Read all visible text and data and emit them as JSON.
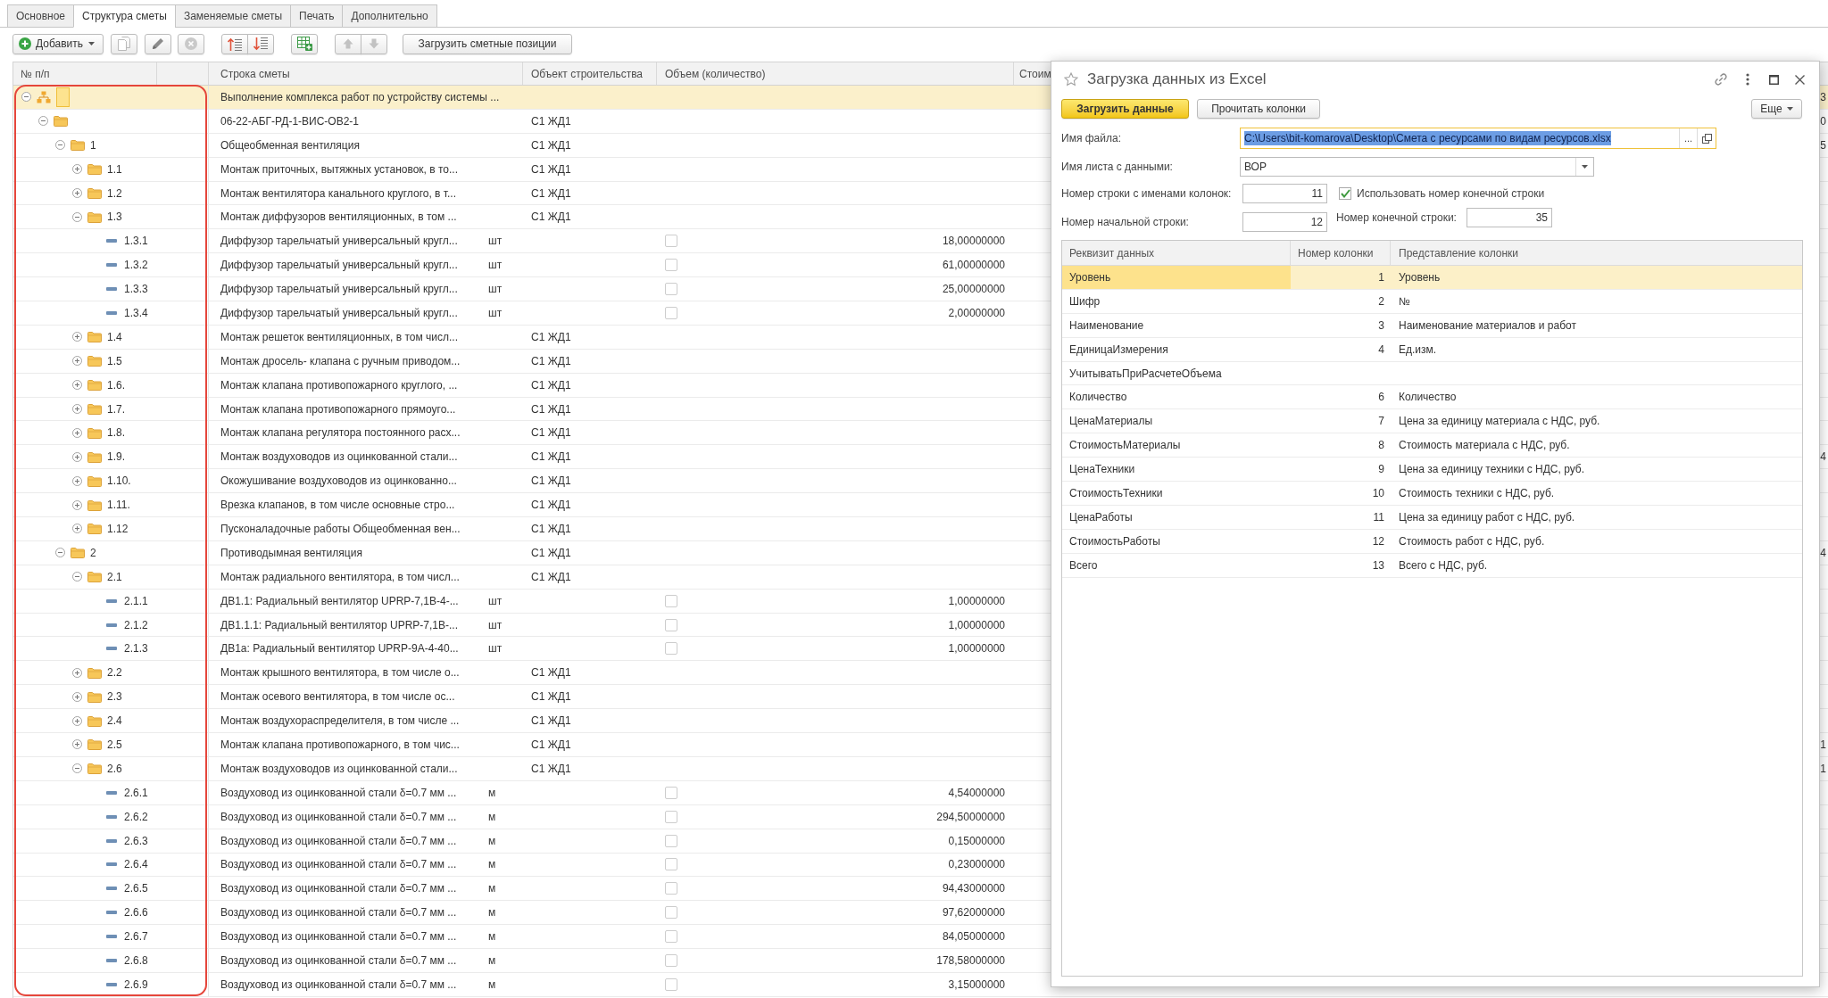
{
  "tabs": [
    {
      "label": "Основное",
      "selected": false
    },
    {
      "label": "Структура сметы",
      "selected": true
    },
    {
      "label": "Заменяемые сметы",
      "selected": false
    },
    {
      "label": "Печать",
      "selected": false
    },
    {
      "label": "Дополнительно",
      "selected": false
    }
  ],
  "toolbar": {
    "add_button": {
      "label": "Добавить"
    },
    "icon_buttons": [
      {
        "kind": "copy",
        "disabled": true
      },
      {
        "kind": "edit",
        "disabled": false
      },
      {
        "kind": "delete",
        "disabled": true
      },
      {
        "kind": "raise",
        "disabled": false
      },
      {
        "kind": "lower",
        "disabled": false
      },
      {
        "kind": "table_add",
        "disabled": false
      },
      {
        "kind": "up",
        "disabled": true
      },
      {
        "kind": "down",
        "disabled": true
      }
    ],
    "load_button": {
      "label": "Загрузить сметные позиции"
    }
  },
  "estimate_table": {
    "columns": [
      "№ п/п",
      "Строка сметы",
      "Объект строительства",
      "Объем (количество)",
      "Стоим"
    ],
    "rows": [
      {
        "kind": "root",
        "name": "Выполнение комплекса работ по устройству системы ...",
        "edge_value": "3",
        "expanded": true,
        "selected": true,
        "children": [
          {
            "kind": "group",
            "name": "06-22-АБГ-РД-1-ВИС-ОВ2-1",
            "object": "С1 ЖД1",
            "edge_value": "0",
            "expanded": true,
            "selected": false,
            "children": [
              {
                "kind": "group",
                "number": "1",
                "name": "Общеобменная вентиляция",
                "object": "С1 ЖД1",
                "edge_value": "5",
                "expanded": true,
                "selected": false,
                "children": [
                  {
                    "kind": "group",
                    "number": "1.1",
                    "name": "Монтаж приточных, вытяжных установок, в то...",
                    "object": "С1 ЖД1",
                    "expanded": false,
                    "selected": false
                  },
                  {
                    "kind": "group",
                    "number": "1.2",
                    "name": "Монтаж вентилятора канального круглого, в т...",
                    "object": "С1 ЖД1",
                    "expanded": false,
                    "selected": false
                  },
                  {
                    "kind": "group",
                    "number": "1.3",
                    "name": "Монтаж диффузоров вентиляционных, в том ...",
                    "object": "С1 ЖД1",
                    "expanded": true,
                    "selected": false,
                    "children": [
                      {
                        "kind": "item",
                        "number": "1.3.1",
                        "name": "Диффузор тарельчатый универсальный кругл...",
                        "unit": "шт",
                        "checked": false,
                        "quantity": "18,00000000",
                        "selected": false
                      },
                      {
                        "kind": "item",
                        "number": "1.3.2",
                        "name": "Диффузор тарельчатый универсальный кругл...",
                        "unit": "шт",
                        "checked": false,
                        "quantity": "61,00000000",
                        "selected": false
                      },
                      {
                        "kind": "item",
                        "number": "1.3.3",
                        "name": "Диффузор тарельчатый универсальный кругл...",
                        "unit": "шт",
                        "checked": false,
                        "quantity": "25,00000000",
                        "selected": false
                      },
                      {
                        "kind": "item",
                        "number": "1.3.4",
                        "name": "Диффузор тарельчатый универсальный кругл...",
                        "unit": "шт",
                        "checked": false,
                        "quantity": "2,00000000",
                        "selected": false
                      }
                    ]
                  },
                  {
                    "kind": "group",
                    "number": "1.4",
                    "name": "Монтаж решеток вентиляционных, в том числ...",
                    "object": "С1 ЖД1",
                    "expanded": false,
                    "selected": false
                  },
                  {
                    "kind": "group",
                    "number": "1.5",
                    "name": "Монтаж дросель- клапана с ручным приводом...",
                    "object": "С1 ЖД1",
                    "expanded": false,
                    "selected": false
                  },
                  {
                    "kind": "group",
                    "number": "1.6.",
                    "name": "Монтаж клапана противопожарного круглого, ...",
                    "object": "С1 ЖД1",
                    "expanded": false,
                    "selected": false
                  },
                  {
                    "kind": "group",
                    "number": "1.7.",
                    "name": "Монтаж клапана противопожарного прямоуго...",
                    "object": "С1 ЖД1",
                    "expanded": false,
                    "selected": false
                  },
                  {
                    "kind": "group",
                    "number": "1.8.",
                    "name": "Монтаж клапана регулятора постоянного расх...",
                    "object": "С1 ЖД1",
                    "expanded": false,
                    "selected": false
                  },
                  {
                    "kind": "group",
                    "number": "1.9.",
                    "name": "Монтаж воздуховодов из оцинкованной стали...",
                    "object": "С1 ЖД1",
                    "edge_value": "4",
                    "expanded": false,
                    "selected": false
                  },
                  {
                    "kind": "group",
                    "number": "1.10.",
                    "name": "Окожушивание воздуховодов из оцинкованно...",
                    "object": "С1 ЖД1",
                    "expanded": false,
                    "selected": false
                  },
                  {
                    "kind": "group",
                    "number": "1.11.",
                    "name": "Врезка клапанов, в том числе основные стро...",
                    "object": "С1 ЖД1",
                    "expanded": false,
                    "selected": false
                  },
                  {
                    "kind": "group",
                    "number": "1.12",
                    "name": "Пусконаладочные работы Общеобменная вен...",
                    "object": "С1 ЖД1",
                    "expanded": false,
                    "selected": false
                  }
                ]
              },
              {
                "kind": "group",
                "number": "2",
                "name": "Противодымная вентиляция",
                "object": "С1 ЖД1",
                "edge_value": "4",
                "expanded": true,
                "selected": false,
                "children": [
                  {
                    "kind": "group",
                    "number": "2.1",
                    "name": "Монтаж радиального вентилятора, в том числ...",
                    "object": "С1 ЖД1",
                    "expanded": true,
                    "selected": false,
                    "children": [
                      {
                        "kind": "item",
                        "number": "2.1.1",
                        "name": "ДВ1.1: Радиальный вентилятор UPRP-7,1В-4-...",
                        "unit": "шт",
                        "checked": false,
                        "quantity": "1,00000000",
                        "selected": false
                      },
                      {
                        "kind": "item",
                        "number": "2.1.2",
                        "name": "ДВ1.1.1: Радиальный вентилятор UPRP-7,1В-...",
                        "unit": "шт",
                        "checked": false,
                        "quantity": "1,00000000",
                        "selected": false
                      },
                      {
                        "kind": "item",
                        "number": "2.1.3",
                        "name": "ДВ1а: Радиальный вентилятор UPRP-9А-4-40...",
                        "unit": "шт",
                        "checked": false,
                        "quantity": "1,00000000",
                        "selected": false
                      }
                    ]
                  },
                  {
                    "kind": "group",
                    "number": "2.2",
                    "name": "Монтаж крышного вентилятора, в том числе о...",
                    "object": "С1 ЖД1",
                    "expanded": false,
                    "selected": false
                  },
                  {
                    "kind": "group",
                    "number": "2.3",
                    "name": "Монтаж осевого вентилятора, в том числе ос...",
                    "object": "С1 ЖД1",
                    "expanded": false,
                    "selected": false
                  },
                  {
                    "kind": "group",
                    "number": "2.4",
                    "name": "Монтаж воздухораспределителя, в том числе ...",
                    "object": "С1 ЖД1",
                    "expanded": false,
                    "selected": false
                  },
                  {
                    "kind": "group",
                    "number": "2.5",
                    "name": "Монтаж клапана противопожарного, в том чис...",
                    "object": "С1 ЖД1",
                    "edge_value": "1",
                    "expanded": false,
                    "selected": false
                  },
                  {
                    "kind": "group",
                    "number": "2.6",
                    "name": "Монтаж воздуховодов из оцинкованной стали...",
                    "object": "С1 ЖД1",
                    "edge_value": "1",
                    "expanded": true,
                    "selected": false,
                    "children": [
                      {
                        "kind": "item",
                        "number": "2.6.1",
                        "name": "Воздуховод из оцинкованной стали δ=0.7 мм ...",
                        "unit": "м",
                        "checked": false,
                        "quantity": "4,54000000",
                        "selected": false
                      },
                      {
                        "kind": "item",
                        "number": "2.6.2",
                        "name": "Воздуховод из оцинкованной стали δ=0.7 мм ...",
                        "unit": "м",
                        "checked": false,
                        "quantity": "294,50000000",
                        "selected": false
                      },
                      {
                        "kind": "item",
                        "number": "2.6.3",
                        "name": "Воздуховод из оцинкованной стали δ=0.7 мм ...",
                        "unit": "м",
                        "checked": false,
                        "quantity": "0,15000000",
                        "selected": false
                      },
                      {
                        "kind": "item",
                        "number": "2.6.4",
                        "name": "Воздуховод из оцинкованной стали δ=0.7 мм ...",
                        "unit": "м",
                        "checked": false,
                        "quantity": "0,23000000",
                        "selected": false
                      },
                      {
                        "kind": "item",
                        "number": "2.6.5",
                        "name": "Воздуховод из оцинкованной стали δ=0.7 мм ...",
                        "unit": "м",
                        "checked": false,
                        "quantity": "94,43000000",
                        "selected": false
                      },
                      {
                        "kind": "item",
                        "number": "2.6.6",
                        "name": "Воздуховод из оцинкованной стали δ=0.7 мм ...",
                        "unit": "м",
                        "checked": false,
                        "quantity": "97,62000000",
                        "selected": false
                      },
                      {
                        "kind": "item",
                        "number": "2.6.7",
                        "name": "Воздуховод из оцинкованной стали δ=0.7 мм ...",
                        "unit": "м",
                        "checked": false,
                        "quantity": "84,05000000",
                        "selected": false
                      },
                      {
                        "kind": "item",
                        "number": "2.6.8",
                        "name": "Воздуховод из оцинкованной стали δ=0.7 мм ...",
                        "unit": "м",
                        "checked": false,
                        "quantity": "178,58000000",
                        "selected": false
                      },
                      {
                        "kind": "item",
                        "number": "2.6.9",
                        "name": "Воздуховод из оцинкованной стали δ=0.7 мм ...",
                        "unit": "м",
                        "checked": false,
                        "quantity": "3,15000000",
                        "selected": false
                      }
                    ]
                  }
                ]
              }
            ]
          }
        ]
      }
    ]
  },
  "annotations": [
    {
      "kind": "frame"
    }
  ],
  "dialog": {
    "title": "Загрузка данных из Excel",
    "buttons": [
      {
        "label": "Загрузить данные",
        "kind": "primary"
      },
      {
        "label": "Прочитать колонки",
        "kind": "secondary"
      }
    ],
    "more_button": {
      "label": "Еще"
    },
    "file_field": {
      "label": "Имя файла:",
      "value": "C:\\Users\\bit-komarova\\Desktop\\Смета с ресурсами по видам ресурсов.xlsx",
      "browse_label": "...",
      "focused": true
    },
    "sheet_field": {
      "label": "Имя листа с данными:",
      "value": "ВОР"
    },
    "header_row_field": {
      "label": "Номер строки с именами колонок:",
      "value": "11"
    },
    "use_end_row": {
      "label": "Использовать номер конечной строки",
      "checked": true
    },
    "start_row_field": {
      "label": "Номер начальной строки:",
      "value": "12"
    },
    "end_row_field": {
      "label": "Номер конечной строки:",
      "value": "35"
    },
    "table": {
      "columns": [
        "Реквизит данных",
        "Номер колонки",
        "Представление колонки"
      ],
      "rows": [
        {
          "attribute": "Уровень",
          "column_number": "1",
          "presentation": "Уровень",
          "selected": true
        },
        {
          "attribute": "Шифр",
          "column_number": "2",
          "presentation": "№",
          "selected": false
        },
        {
          "attribute": "Наименование",
          "column_number": "3",
          "presentation": "Наименование материалов и работ",
          "selected": false
        },
        {
          "attribute": "ЕдиницаИзмерения",
          "column_number": "4",
          "presentation": "Ед.изм.",
          "selected": false
        },
        {
          "attribute": "УчитыватьПриРасчетеОбъема",
          "selected": false
        },
        {
          "attribute": "Количество",
          "column_number": "6",
          "presentation": "Количество",
          "selected": false
        },
        {
          "attribute": "ЦенаМатериалы",
          "column_number": "7",
          "presentation": "Цена за единицу материала с НДС, руб.",
          "selected": false
        },
        {
          "attribute": "СтоимостьМатериалы",
          "column_number": "8",
          "presentation": "Стоимость  материала с НДС, руб.",
          "selected": false
        },
        {
          "attribute": "ЦенаТехники",
          "column_number": "9",
          "presentation": "Цена за единицу техники  с НДС, руб.",
          "selected": false
        },
        {
          "attribute": "СтоимостьТехники",
          "column_number": "10",
          "presentation": "Стоимость техники с НДС, руб.",
          "selected": false
        },
        {
          "attribute": "ЦенаРаботы",
          "column_number": "11",
          "presentation": "Цена за единицу работ с НДС, руб.",
          "selected": false
        },
        {
          "attribute": "СтоимостьРаботы",
          "column_number": "12",
          "presentation": "Стоимость  работ с НДС, руб.",
          "selected": false
        },
        {
          "attribute": "Всего",
          "column_number": "13",
          "presentation": "Всего с НДС, руб.",
          "selected": false
        }
      ]
    }
  }
}
